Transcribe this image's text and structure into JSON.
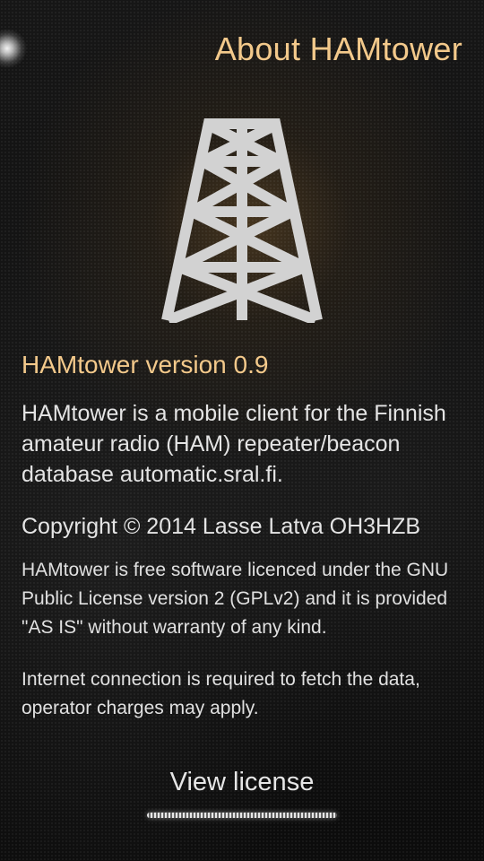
{
  "header": {
    "title": "About HAMtower"
  },
  "icon": {
    "name": "radio-tower-icon"
  },
  "about": {
    "version": "HAMtower version 0.9",
    "description": "HAMtower is a mobile client for the Finnish amateur radio (HAM) repeater/beacon database automatic.sral.fi.",
    "copyright": "Copyright © 2014 Lasse Latva OH3HZB",
    "license_text": "HAMtower is free software licenced under the GNU Public License version 2 (GPLv2) and it is provided \"AS IS\" without warranty of any kind.",
    "internet_notice": "Internet connection is required to fetch the data, operator charges may apply."
  },
  "actions": {
    "view_license": "View license"
  },
  "colors": {
    "accent": "#f3c98b",
    "text": "#e4e4e4",
    "background": "#0f0f0f"
  }
}
